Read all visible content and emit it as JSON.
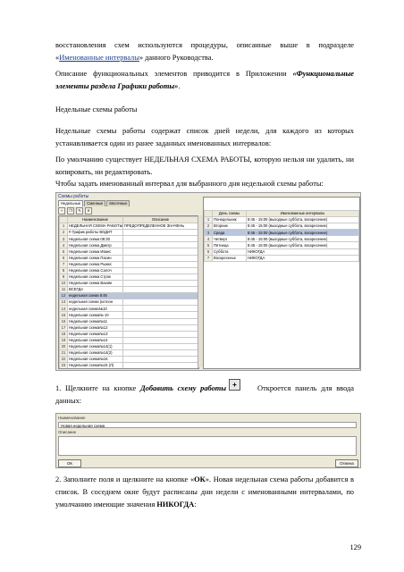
{
  "text": {
    "p1_part1": "восстановления схем используются процедуры, описанные выше в подразделе «",
    "p1_link": "Именованные интервалы",
    "p1_part2": "» данного Руководства.",
    "p2_part1": "Описание функциональных элементов приводится в Приложении ",
    "p2_bi": "«Функциональные элементы раздела Графики работы»",
    "p2_part2": ".",
    "heading": "Недельные схемы работы",
    "p3": "Недельные схемы работы содержат список дней недели, для каждого из которых устанавливается один из ранее заданных именованных интервалов:",
    "p4": "По умолчанию существует НЕДЕЛЬНАЯ СХЕМА РАБОТЫ, которую нельзя ни удалить, ни копировать, ни редактировать.",
    "p5": "Чтобы задать именованный интервал для выбранного дня недельной схемы работы:",
    "step1_part1": "1. Щелкните на кнопке ",
    "step1_bi": "Добавить схему работы",
    "step1_dash": " –",
    "step1_part2": "Откроется панель для ввода данных:",
    "step2_part1": "2. Заполните поля и щелкните на кнопке «",
    "step2_b": "ОК",
    "step2_part2": "». Новая недельная схема работы добавится в список. В соседнем окне будут расписаны дни недели с именованными интервалами, по умолчанию имеющие значения ",
    "step2_b2": "НИКОГДА",
    "step2_part3": ":",
    "page_number": "129"
  },
  "screenshot1": {
    "window_title": "Схемы работы",
    "tabs": [
      "Недельные",
      "Сменные",
      "Месячные"
    ],
    "toolbar_icons": [
      "add-icon",
      "copy-icon",
      "edit-icon",
      "delete-icon"
    ],
    "left_headers": [
      "",
      "Наименование",
      "Описание"
    ],
    "left_rows": [
      [
        "1",
        "НЕДЕЛЬНАЯ СХЕМА РАБОТЫ",
        "ПРЕДОПРЕДЕЛЕННОЕ ЗНАЧЕНЬ"
      ],
      [
        "2",
        "# График работы ВОДИТ",
        ""
      ],
      [
        "3",
        "Недельная схема 08:30",
        ""
      ],
      [
        "4",
        "Недельная схема Дмитр",
        ""
      ],
      [
        "5",
        "Недельная схема Иванс",
        ""
      ],
      [
        "6",
        "Недельная схема Пасин",
        ""
      ],
      [
        "7",
        "Недельная схема Рыжкс",
        ""
      ],
      [
        "8",
        "Недельная схема Салоч",
        ""
      ],
      [
        "9",
        "Недельная схема Строк",
        ""
      ],
      [
        "10",
        "Недельная схема Вахим",
        ""
      ],
      [
        "11",
        "ВСЕГДА",
        ""
      ],
      [
        "12",
        "недельная схема 8:45",
        ""
      ],
      [
        "13",
        "недельная схема (котлон",
        ""
      ],
      [
        "14",
        "недельная схема№10",
        ""
      ],
      [
        "15",
        "Недельная схема№ 10",
        ""
      ],
      [
        "16",
        "Недельная схема№11",
        ""
      ],
      [
        "17",
        "Недельная схема№12",
        ""
      ],
      [
        "18",
        "Недельная схема№13",
        ""
      ],
      [
        "19",
        "Недельная схема№14",
        ""
      ],
      [
        "20",
        "Недельная схема№14(1)",
        ""
      ],
      [
        "21",
        "Недельная схема№14(2)",
        ""
      ],
      [
        "22",
        "Недельная схема№15",
        ""
      ],
      [
        "23",
        "Недельная схема№15 (Л)",
        ""
      ]
    ],
    "selected_left_row": 11,
    "right_headers": [
      "",
      "День схемы",
      "Именованные интервалы"
    ],
    "right_rows": [
      [
        "1",
        "Понедельник",
        "8:45 - 15:00 (выходные суббота, воскресение)"
      ],
      [
        "2",
        "Вторник",
        "8:45 - 15:00 (выходные суббота, воскресение)"
      ],
      [
        "3",
        "Среда",
        "8:45 - 15:00 (выходные суббота, воскресение)"
      ],
      [
        "4",
        "Четверг",
        "8:45 - 15:00 (выходные суббота, воскресение)"
      ],
      [
        "5",
        "Пятница",
        "8:45 - 15:00 (выходные суббота, воскресение)"
      ],
      [
        "6",
        "Суббота",
        "НИКОГДА"
      ],
      [
        "7",
        "Воскресенье",
        "НИКОГДА"
      ]
    ],
    "selected_right_row": 2
  },
  "screenshot2": {
    "name_label": "Наименование",
    "name_value": "Новая недельная схема",
    "desc_label": "Описание",
    "desc_value": "",
    "ok_label": "ОК",
    "cancel_label": "Отмена"
  }
}
